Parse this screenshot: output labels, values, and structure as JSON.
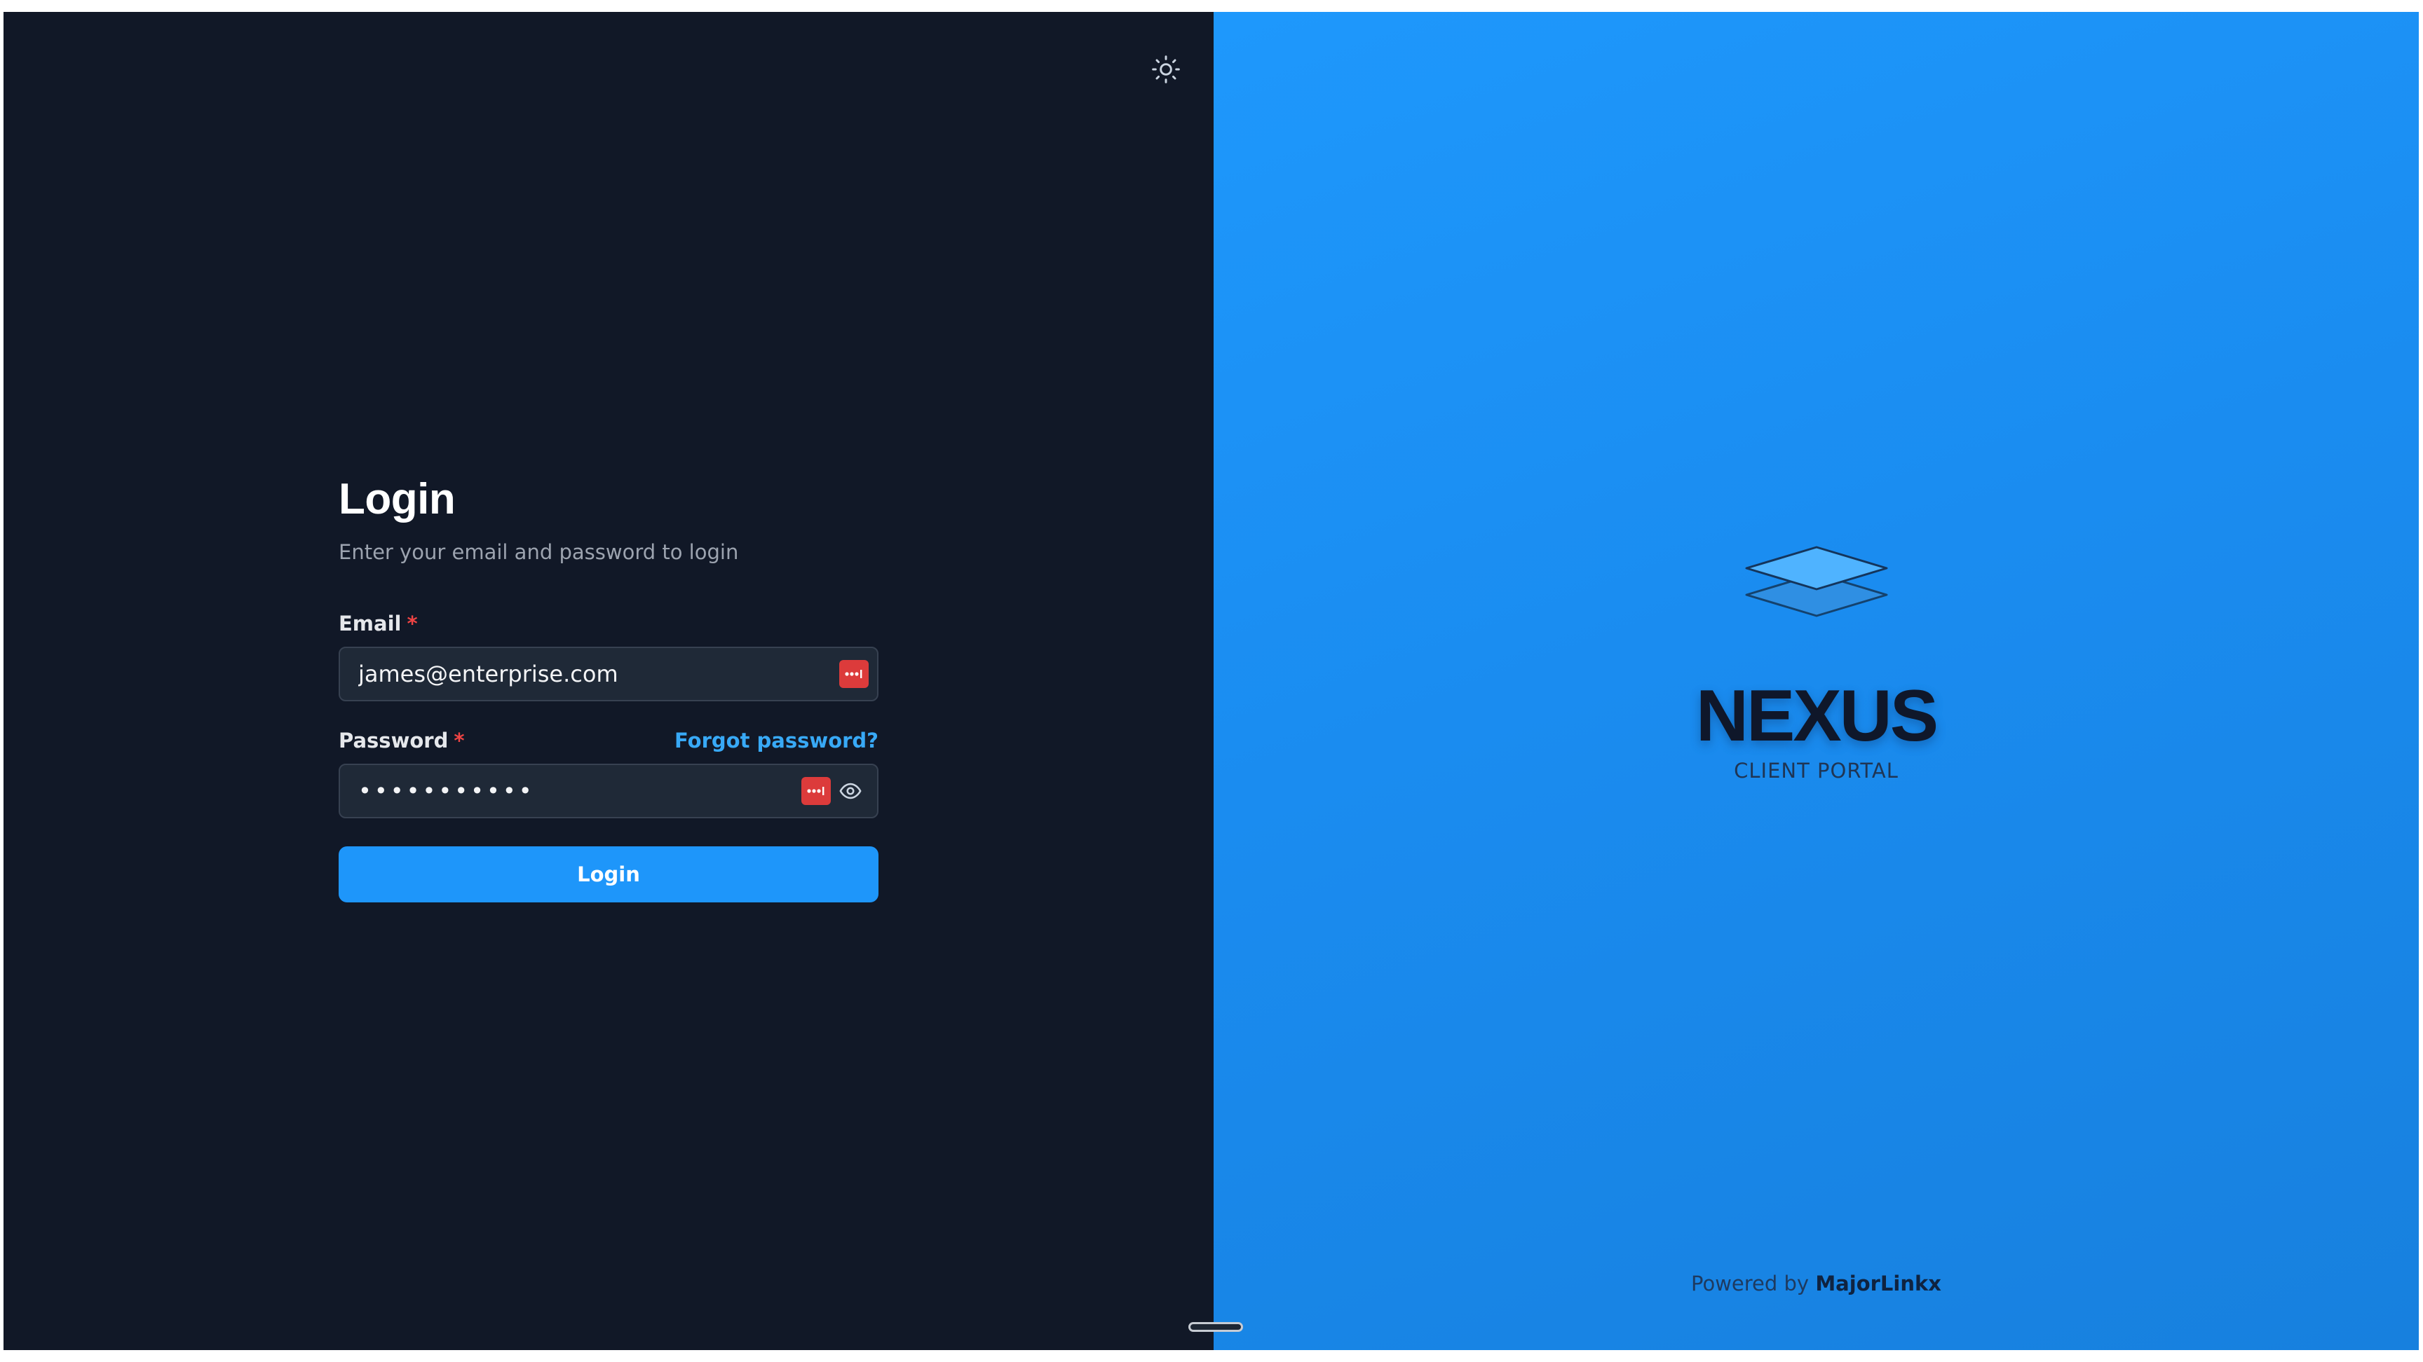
{
  "login": {
    "title": "Login",
    "subtitle": "Enter your email and password to login",
    "email_label": "Email",
    "email_value": "james@enterprise.com",
    "password_label": "Password",
    "password_value": "•••••••••••",
    "forgot_label": "Forgot password?",
    "required_mark": "*",
    "submit_label": "Login"
  },
  "brand": {
    "name": "NEXUS",
    "tagline": "CLIENT PORTAL",
    "powered_prefix": "Powered by",
    "powered_company": "MajorLinkx"
  },
  "icons": {
    "theme_toggle": "sun-icon",
    "password_manager": "password-manager-icon",
    "show_password": "eye-icon",
    "logo": "layers-icon"
  },
  "colors": {
    "left_background": "#111827",
    "right_background": "#1e98fc",
    "accent": "#1e96fa",
    "link": "#38a9f6",
    "required": "#ef4444",
    "password_manager": "#dc3b3b"
  }
}
